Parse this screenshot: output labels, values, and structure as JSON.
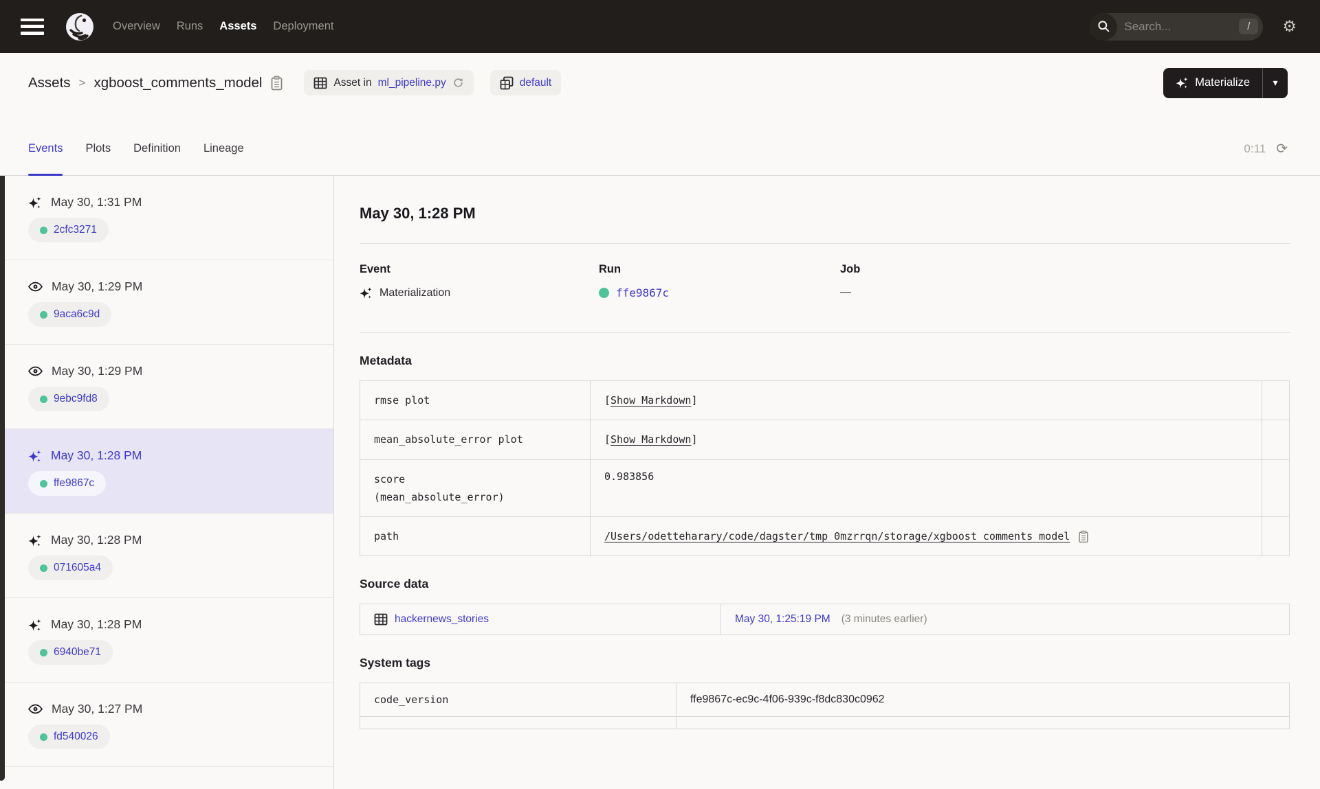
{
  "colors": {
    "accent": "#3d39cd",
    "success_green": "#4cc49c",
    "nav_bg": "#211e1c",
    "selected_bg": "#e7e4f6",
    "page_bg": "#faf9f7"
  },
  "nav": {
    "items": [
      {
        "label": "Overview",
        "active": false
      },
      {
        "label": "Runs",
        "active": false
      },
      {
        "label": "Assets",
        "active": true
      },
      {
        "label": "Deployment",
        "active": false
      }
    ],
    "search_placeholder": "Search...",
    "search_shortcut": "/",
    "gear_glyph": "⚙"
  },
  "breadcrumb": {
    "root": "Assets",
    "separator": ">",
    "asset": "xgboost_comments_model"
  },
  "badges": {
    "asset_in_prefix": "Asset in",
    "asset_in_link": "ml_pipeline.py",
    "repo_label": "default"
  },
  "materialize": {
    "label": "Materialize",
    "caret": "▾"
  },
  "tabs": {
    "items": [
      {
        "label": "Events",
        "active": true
      },
      {
        "label": "Plots",
        "active": false
      },
      {
        "label": "Definition",
        "active": false
      },
      {
        "label": "Lineage",
        "active": false
      }
    ],
    "refresh_timer": "0:11",
    "refresh_glyph": "⟳"
  },
  "events_list": [
    {
      "type": "materialization",
      "time": "May 30, 1:31 PM",
      "run_id": "2cfc3271",
      "selected": false
    },
    {
      "type": "observation",
      "time": "May 30, 1:29 PM",
      "run_id": "9aca6c9d",
      "selected": false
    },
    {
      "type": "observation",
      "time": "May 30, 1:29 PM",
      "run_id": "9ebc9fd8",
      "selected": false
    },
    {
      "type": "materialization",
      "time": "May 30, 1:28 PM",
      "run_id": "ffe9867c",
      "selected": true
    },
    {
      "type": "materialization",
      "time": "May 30, 1:28 PM",
      "run_id": "071605a4",
      "selected": false
    },
    {
      "type": "materialization",
      "time": "May 30, 1:28 PM",
      "run_id": "6940be71",
      "selected": false
    },
    {
      "type": "observation",
      "time": "May 30, 1:27 PM",
      "run_id": "fd540026",
      "selected": false
    }
  ],
  "detail": {
    "title": "May 30, 1:28 PM",
    "event_label": "Event",
    "event_value": "Materialization",
    "run_label": "Run",
    "run_value": "ffe9867c",
    "job_label": "Job",
    "job_value": "—",
    "metadata": {
      "heading": "Metadata",
      "markdown_open": "[",
      "markdown_label": "Show Markdown",
      "markdown_close": "]",
      "rows": [
        {
          "key": "rmse plot",
          "value_type": "markdown"
        },
        {
          "key": "mean_absolute_error plot",
          "value_type": "markdown"
        },
        {
          "key": "score\n(mean_absolute_error)",
          "value": "0.983856"
        },
        {
          "key": "path",
          "value": "/Users/odetteharary/code/dagster/tmp_0mzrrqn/storage/xgboost_comments_model"
        }
      ]
    },
    "source_data": {
      "heading": "Source data",
      "asset": "hackernews_stories",
      "time": "May 30, 1:25:19 PM",
      "note": "(3 minutes earlier)"
    },
    "system_tags": {
      "heading": "System tags",
      "rows": [
        {
          "key": "code_version",
          "value": "ffe9867c-ec9c-4f06-939c-f8dc830c0962"
        }
      ]
    }
  }
}
